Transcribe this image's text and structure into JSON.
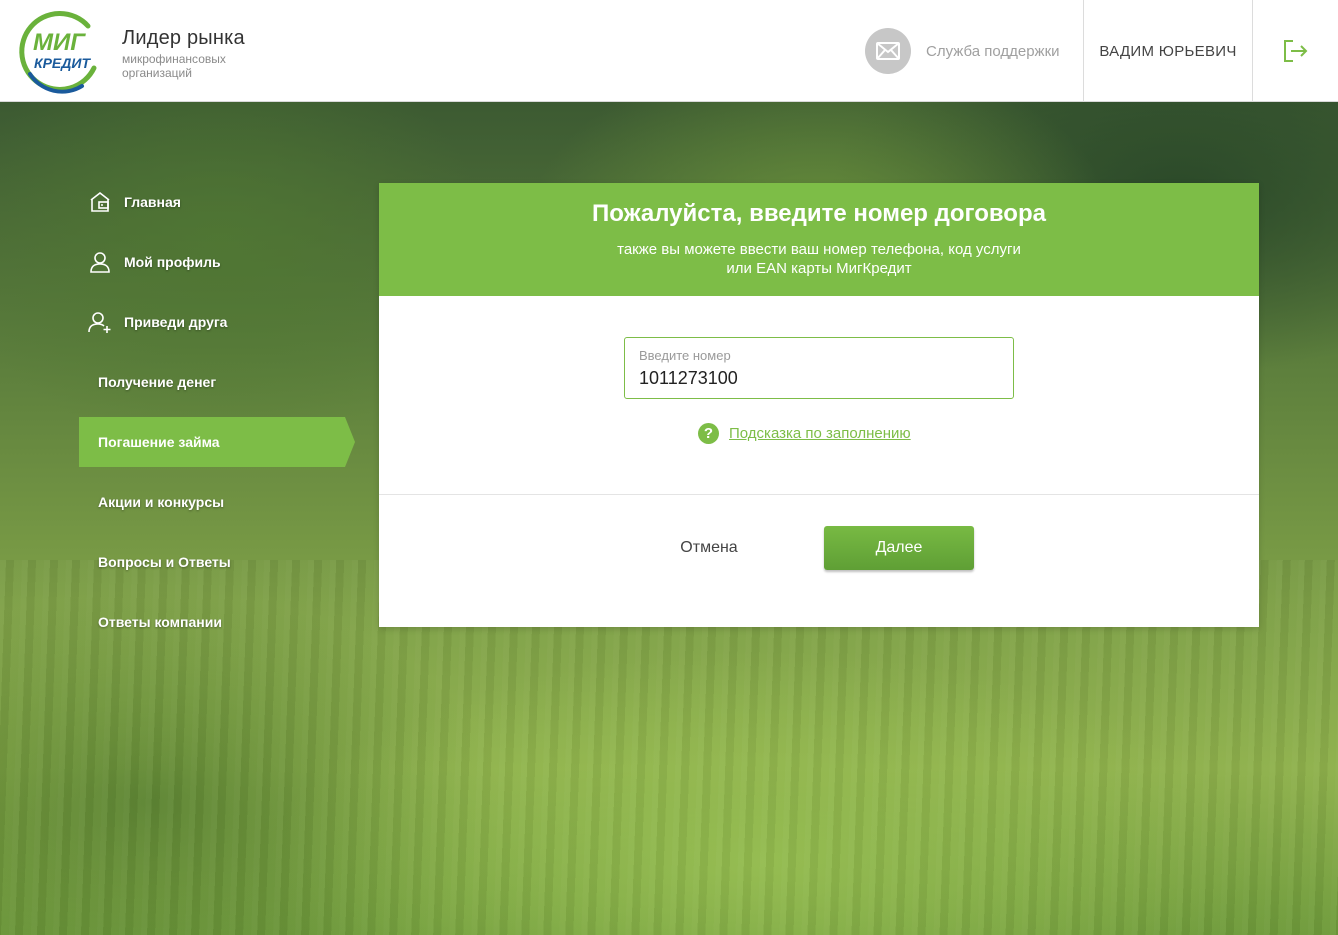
{
  "header": {
    "logo": {
      "line1": "МИГ",
      "line2": "КРЕДИТ",
      "icon": "migkredit-logo"
    },
    "brand_title": "Лидер рынка",
    "brand_subtitle": "микрофинансовых организаций",
    "support_label": "Служба поддержки",
    "support_icon": "envelope-icon",
    "user_name": "ВАДИМ ЮРЬЕВИЧ",
    "logout_icon": "logout-icon"
  },
  "sidebar": {
    "items": [
      {
        "label": "Главная",
        "icon": "home-wallet-icon",
        "active": false
      },
      {
        "label": "Мой профиль",
        "icon": "user-icon",
        "active": false
      },
      {
        "label": "Приведи друга",
        "icon": "add-user-icon",
        "active": false
      },
      {
        "label": "Получение денег",
        "icon": "",
        "active": false
      },
      {
        "label": "Погашение займа",
        "icon": "",
        "active": true
      },
      {
        "label": "Акции и конкурсы",
        "icon": "",
        "active": false
      },
      {
        "label": "Вопросы и Ответы",
        "icon": "",
        "active": false
      },
      {
        "label": "Ответы компании",
        "icon": "",
        "active": false
      }
    ]
  },
  "panel": {
    "title": "Пожалуйста, введите номер договора",
    "subtitle_line1": "также вы можете ввести ваш номер телефона, код услуги",
    "subtitle_line2": "или EAN карты МигКредит",
    "field_label": "Введите номер",
    "field_value": "1011273100",
    "hint_label": "Подсказка по заполнению",
    "hint_icon_glyph": "?",
    "cancel_label": "Отмена",
    "next_label": "Далее"
  },
  "colors": {
    "accent": "#7dbd47",
    "button": "#5f9f35",
    "logo_green": "#6ab23b",
    "logo_blue": "#1a5a9c"
  }
}
